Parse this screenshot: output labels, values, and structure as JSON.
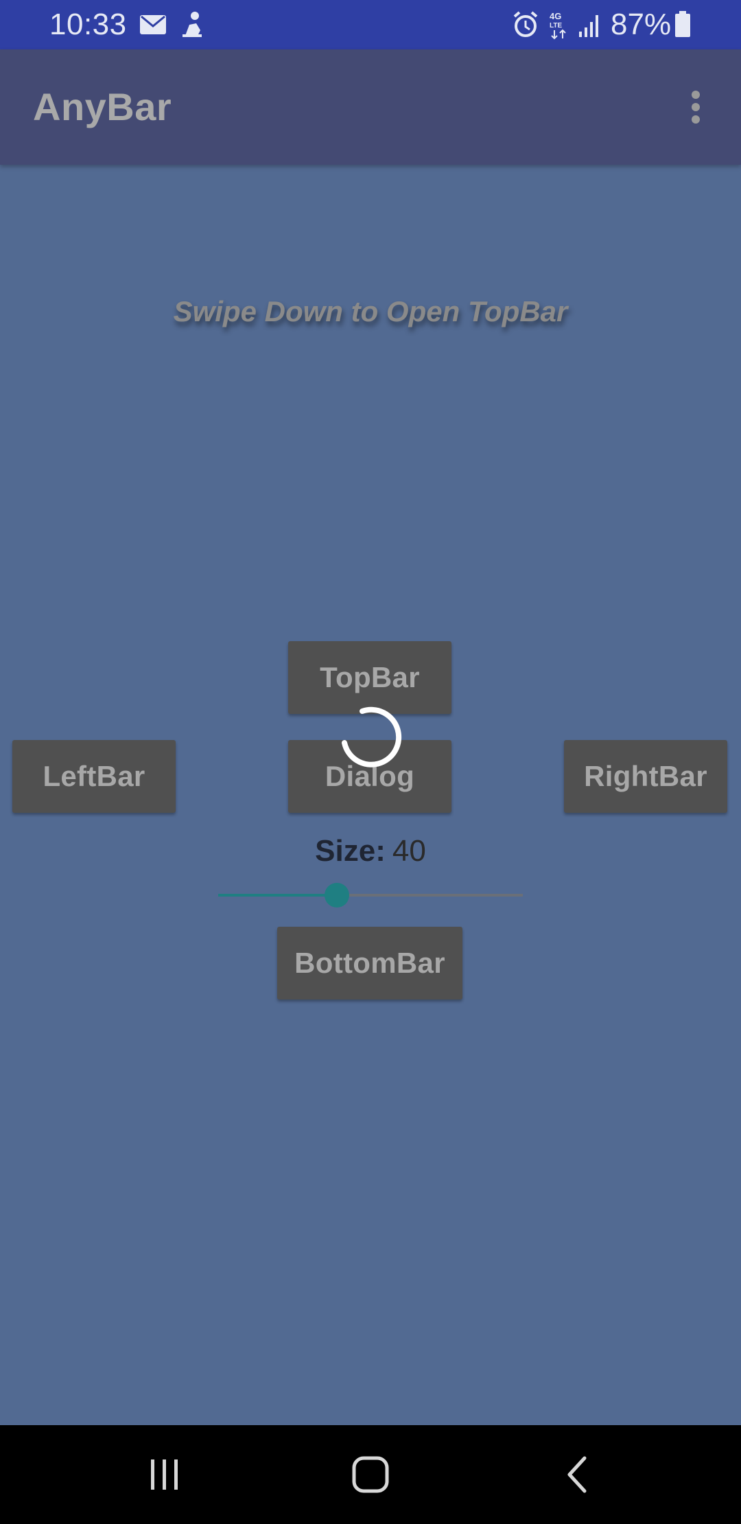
{
  "status_bar": {
    "time": "10:33",
    "battery": "87%",
    "icons": [
      "email-icon",
      "notification-icon",
      "alarm-icon",
      "4g-lte-icon",
      "signal-icon",
      "battery-icon"
    ]
  },
  "app_bar": {
    "title": "AnyBar",
    "menu_icon": "more-vert-icon"
  },
  "main": {
    "hint": "Swipe Down to Open TopBar",
    "buttons": {
      "top": "TopBar",
      "left": "LeftBar",
      "dialog": "Dialog",
      "right": "RightBar",
      "bottom": "BottomBar"
    },
    "size_label": "Size:",
    "size_value": "40",
    "slider_fraction": 0.39,
    "loading": true
  },
  "nav_bar": {
    "icons": [
      "recent-apps-icon",
      "home-icon",
      "back-icon"
    ]
  },
  "colors": {
    "status_bar": "#2f3fa4",
    "app_bar": "#444a73",
    "background": "#526a92",
    "button": "#505050",
    "accent": "#1f7f82"
  }
}
